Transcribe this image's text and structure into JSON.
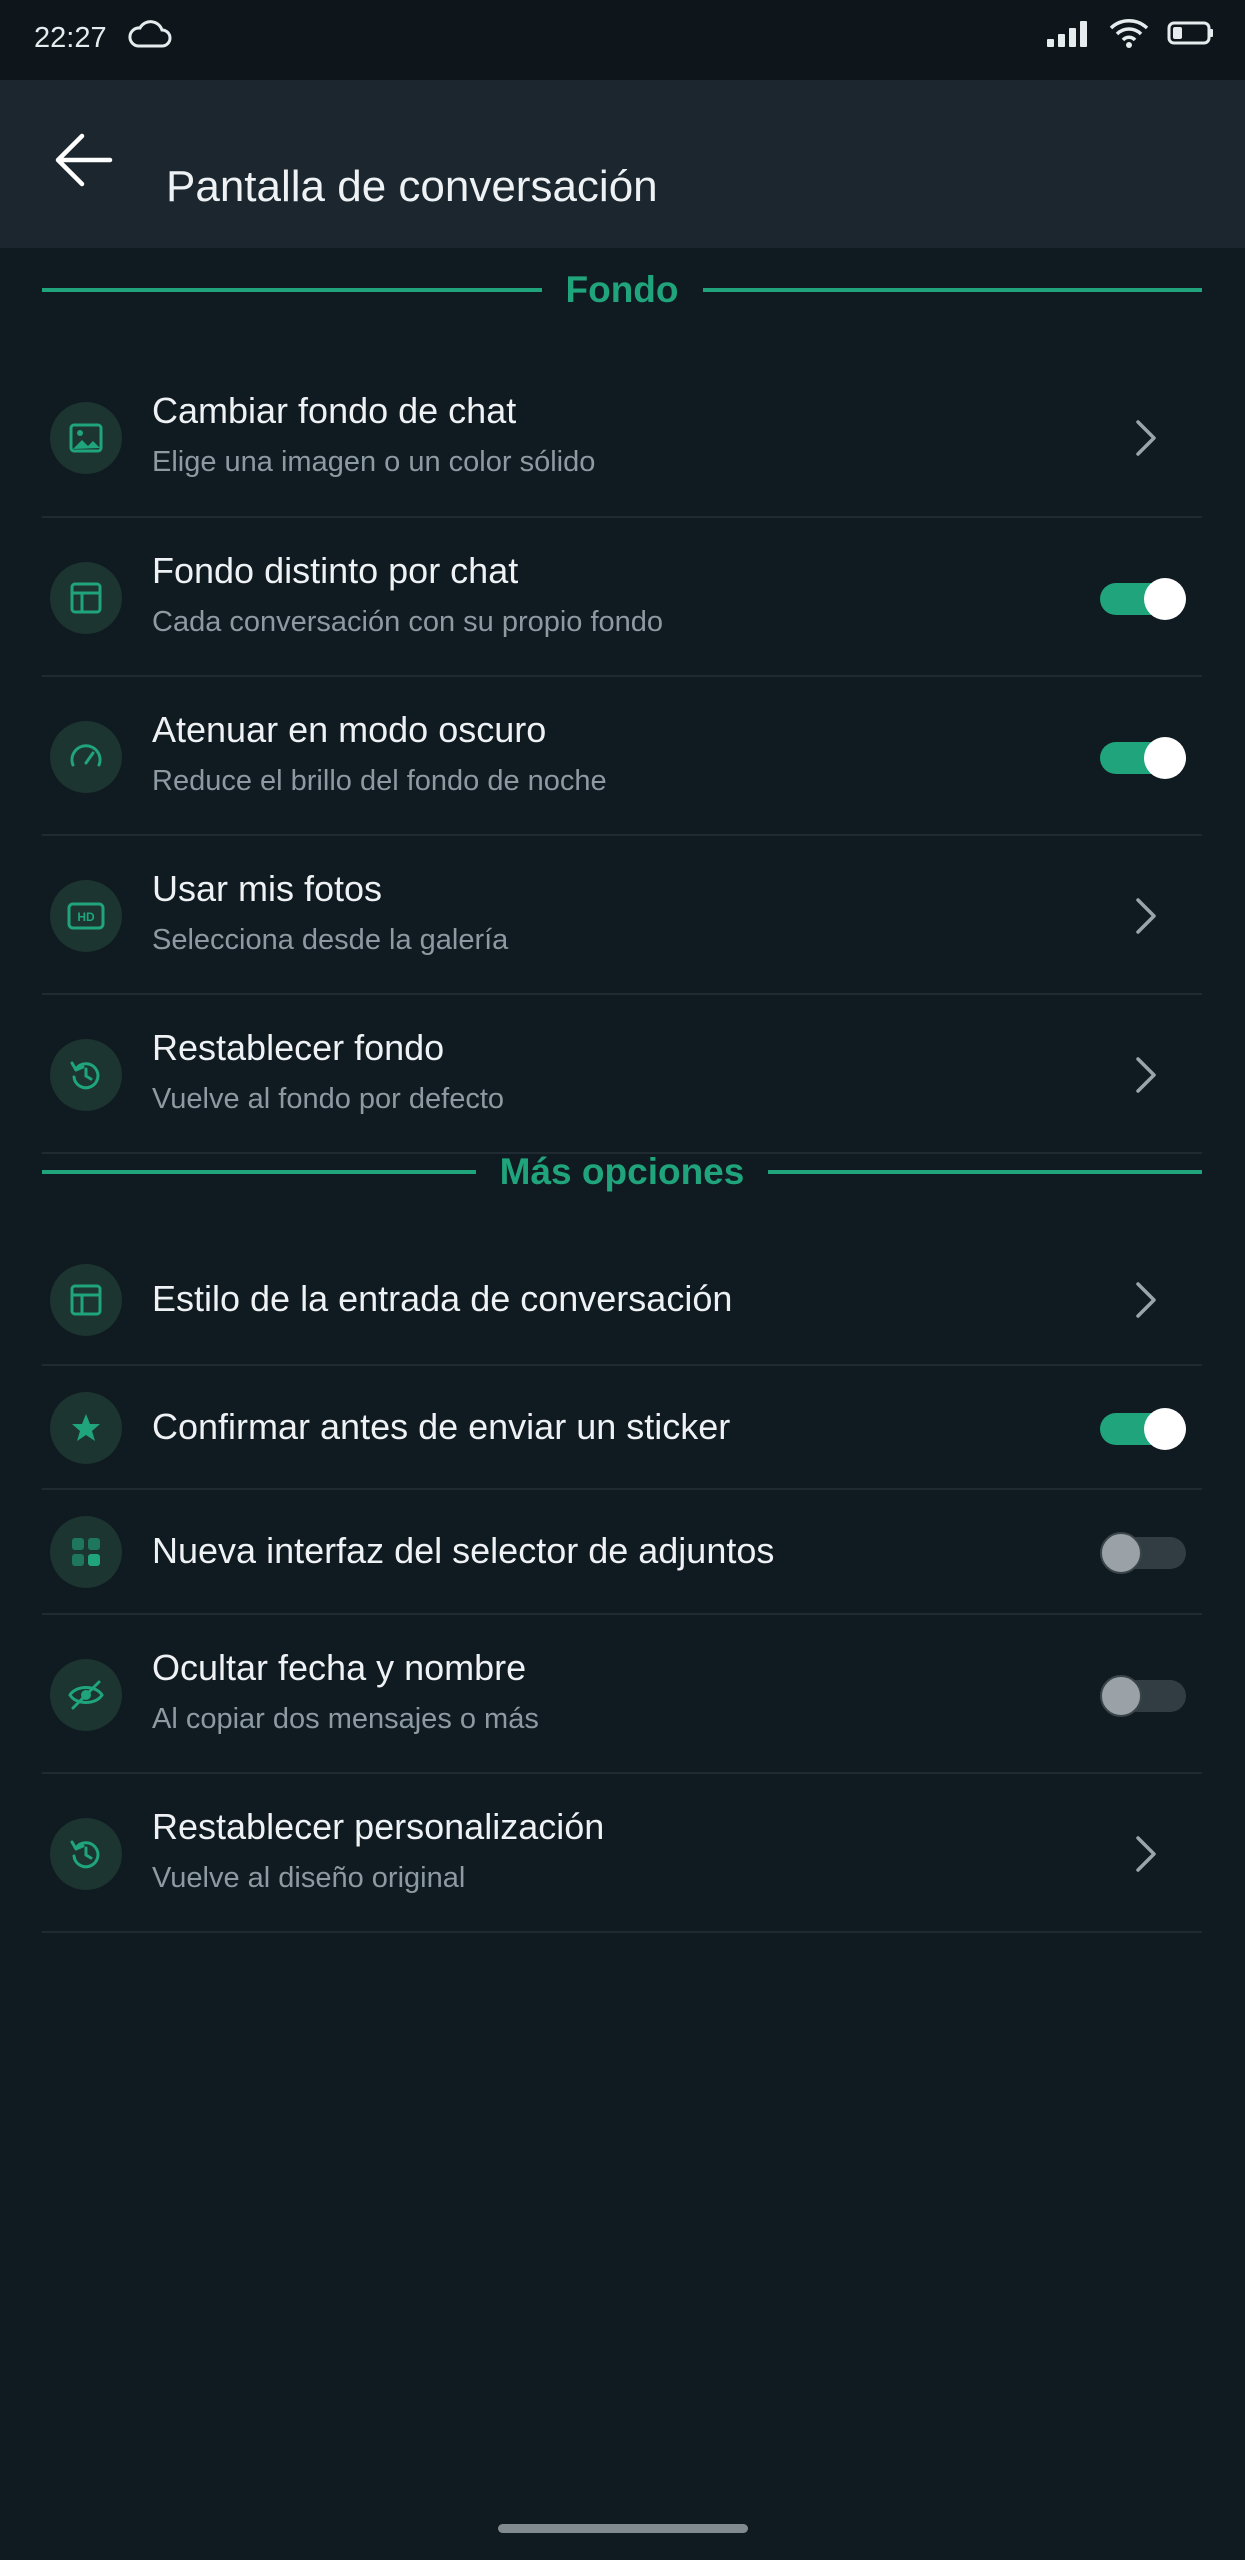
{
  "status_bar": {
    "time": "22:27",
    "icons": [
      "cloud-icon",
      "signal-icon",
      "wifi-icon",
      "battery-icon"
    ]
  },
  "app_bar": {
    "title": "Pantalla de conversación",
    "back_icon": "arrow-left-icon"
  },
  "sections": {
    "fondo": {
      "title": "Fondo",
      "items": [
        {
          "title": "Cambiar fondo de chat",
          "subtitle": "Elige una imagen o un color sólido",
          "icon": "image-icon",
          "control": "chevron"
        },
        {
          "title": "Fondo distinto por chat",
          "subtitle": "Cada conversación con su propio fondo",
          "icon": "layout-icon",
          "control": "toggle",
          "on": true
        },
        {
          "title": "Atenuar en modo oscuro",
          "subtitle": "Reduce el brillo del fondo de noche",
          "icon": "gauge-icon",
          "control": "toggle",
          "on": true
        },
        {
          "title": "Usar mis fotos",
          "subtitle": "Selecciona desde la galería",
          "icon": "hd-icon",
          "control": "chevron"
        },
        {
          "title": "Restablecer fondo",
          "subtitle": "Vuelve al fondo por defecto",
          "icon": "reset-icon",
          "control": "chevron"
        }
      ]
    },
    "mas_opciones": {
      "title": "Más opciones",
      "items": [
        {
          "title": "Estilo de la entrada de conversación",
          "icon": "layout-icon",
          "control": "chevron"
        },
        {
          "title": "Confirmar antes de enviar un sticker",
          "icon": "star-icon",
          "control": "toggle",
          "on": true
        },
        {
          "title": "Nueva interfaz del selector de adjuntos",
          "icon": "grid-icon",
          "control": "toggle",
          "on": false
        },
        {
          "title": "Ocultar fecha y nombre",
          "subtitle": "Al copiar dos mensajes o más",
          "icon": "eye-off-icon",
          "control": "toggle",
          "on": false
        },
        {
          "title": "Restablecer personalización",
          "subtitle": "Vuelve al diseño original",
          "icon": "reset-icon",
          "control": "chevron"
        }
      ]
    }
  },
  "colors": {
    "accent": "#1fa47c",
    "background": "#101a21",
    "app_bar": "#1b262e"
  }
}
